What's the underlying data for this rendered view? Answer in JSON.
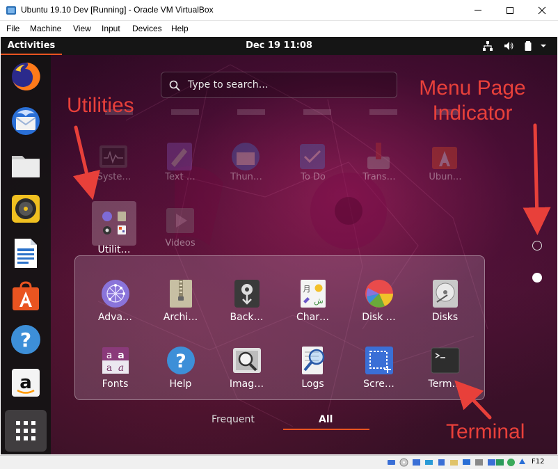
{
  "window": {
    "title": "Ubuntu 19.10 Dev [Running] - Oracle VM VirtualBox",
    "menu": [
      "File",
      "Machine",
      "View",
      "Input",
      "Devices",
      "Help"
    ]
  },
  "topbar": {
    "activities": "Activities",
    "clock": "Dec 19  11:08"
  },
  "search": {
    "placeholder": "Type to search…"
  },
  "ghost_apps": [
    {
      "label": "Syste…",
      "icon": "system-monitor-icon"
    },
    {
      "label": "Text …",
      "icon": "text-editor-icon"
    },
    {
      "label": "Thun…",
      "icon": "thunderbird-icon"
    },
    {
      "label": "To Do",
      "icon": "todo-icon"
    },
    {
      "label": "Trans…",
      "icon": "transmission-icon"
    },
    {
      "label": "Ubun…",
      "icon": "ubuntu-software-icon"
    }
  ],
  "utilities_folder": {
    "label": "Utilit…"
  },
  "videos_label": "Videos",
  "utilities": [
    {
      "label": "Adva…",
      "icon": "advanced-network-icon"
    },
    {
      "label": "Archi…",
      "icon": "archive-manager-icon"
    },
    {
      "label": "Back…",
      "icon": "backups-icon"
    },
    {
      "label": "Char…",
      "icon": "characters-icon"
    },
    {
      "label": "Disk …",
      "icon": "disk-usage-icon"
    },
    {
      "label": "Disks",
      "icon": "disks-icon"
    },
    {
      "label": "Fonts",
      "icon": "fonts-icon"
    },
    {
      "label": "Help",
      "icon": "help-icon"
    },
    {
      "label": "Imag…",
      "icon": "image-viewer-icon"
    },
    {
      "label": "Logs",
      "icon": "logs-icon"
    },
    {
      "label": "Scre…",
      "icon": "screenshot-icon"
    },
    {
      "label": "Term…",
      "icon": "terminal-icon"
    }
  ],
  "tabs": {
    "frequent": "Frequent",
    "all": "All"
  },
  "annotations": {
    "utilities": "Utilities",
    "menu_page_line1": "Menu Page",
    "menu_page_line2": "Indicator",
    "terminal": "Terminal"
  },
  "statusbar": {
    "host_key": "F12"
  },
  "colors": {
    "accent": "#e95420",
    "annotation": "#e8403a"
  }
}
